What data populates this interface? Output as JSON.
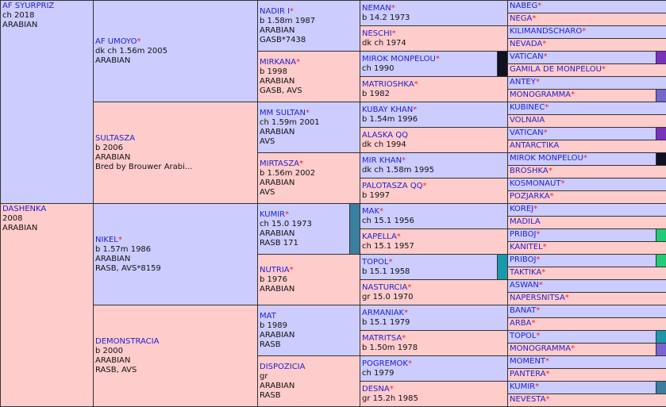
{
  "gen1": [
    {
      "name": "AF SYURPRIZ",
      "star": false,
      "lines": [
        "ch 2018",
        "ARABIAN"
      ],
      "color": "blue"
    },
    {
      "name": "DASHENKA",
      "star": false,
      "lines": [
        "2008",
        "ARABIAN"
      ],
      "color": "pink"
    }
  ],
  "gen2": [
    {
      "name": "AF UMOYO",
      "star": true,
      "lines": [
        "dk ch 1.56m 2005",
        "ARABIAN"
      ],
      "color": "blue"
    },
    {
      "name": "SULTASZA",
      "star": false,
      "lines": [
        "b 2006",
        "ARABIAN",
        "Bred by Brouwer Arabi..."
      ],
      "color": "pink"
    },
    {
      "name": "NIKEL",
      "star": true,
      "lines": [
        "b 1.57m 1986",
        "ARABIAN",
        "RASB, AVS*8159"
      ],
      "color": "blue"
    },
    {
      "name": "DEMONSTRACIA",
      "star": false,
      "lines": [
        "b 2000",
        "ARABIAN",
        "RASB, AVS"
      ],
      "color": "pink"
    }
  ],
  "gen3": [
    {
      "name": "NADIR I",
      "star": true,
      "lines": [
        "b 1.58m 1987",
        "ARABIAN",
        "GASB*7438"
      ],
      "color": "blue"
    },
    {
      "name": "MIRKANA",
      "star": true,
      "lines": [
        "b 1998",
        "ARABIAN",
        "GASB, AVS"
      ],
      "color": "pink"
    },
    {
      "name": "MM SULTAN",
      "star": true,
      "lines": [
        "ch 1.59m 2001",
        "ARABIAN",
        "AVS"
      ],
      "color": "blue"
    },
    {
      "name": "MIRTASZA",
      "star": true,
      "lines": [
        "b 1.56m 2002",
        "ARABIAN",
        "AVS"
      ],
      "color": "pink"
    },
    {
      "name": "KUMIR",
      "star": true,
      "lines": [
        "ch 15.0 1973",
        "ARABIAN",
        "RASB 171"
      ],
      "color": "blue",
      "swatch": "#3a7ea0"
    },
    {
      "name": "NUTRIA",
      "star": true,
      "lines": [
        "b 1976",
        "ARABIAN"
      ],
      "color": "pink"
    },
    {
      "name": "MAT",
      "star": false,
      "lines": [
        "b 1989",
        "ARABIAN",
        "RASB"
      ],
      "color": "blue"
    },
    {
      "name": "DISPOZICIA",
      "star": false,
      "lines": [
        "gr",
        "ARABIAN",
        "RASB"
      ],
      "color": "pink"
    }
  ],
  "gen4": [
    {
      "name": "NEMAN",
      "star": true,
      "lines": [
        "b 14.2 1973"
      ],
      "color": "blue"
    },
    {
      "name": "NESCHI",
      "star": true,
      "lines": [
        "dk ch 1974"
      ],
      "color": "pink"
    },
    {
      "name": "MIROK MONPELOU",
      "star": true,
      "lines": [
        "ch 1990"
      ],
      "color": "blue",
      "swatch": "#111122"
    },
    {
      "name": "MATRIOSHKA",
      "star": true,
      "lines": [
        "b 1982"
      ],
      "color": "pink"
    },
    {
      "name": "KUBAY KHAN",
      "star": true,
      "lines": [
        "b 1.54m 1996"
      ],
      "color": "blue"
    },
    {
      "name": "ALASKA QQ",
      "star": false,
      "lines": [
        "dk ch 1994"
      ],
      "color": "pink"
    },
    {
      "name": "MIR KHAN",
      "star": true,
      "lines": [
        "dk ch 1.58m 1995"
      ],
      "color": "blue"
    },
    {
      "name": "PALOTASZA QQ",
      "star": true,
      "lines": [
        "b 1997"
      ],
      "color": "pink"
    },
    {
      "name": "MAK",
      "star": true,
      "lines": [
        "ch 15.1 1956"
      ],
      "color": "blue"
    },
    {
      "name": "KAPELLA",
      "star": true,
      "lines": [
        "ch 15.1 1957"
      ],
      "color": "pink"
    },
    {
      "name": "TOPOL",
      "star": true,
      "lines": [
        "b 15.1 1958"
      ],
      "color": "blue",
      "swatch": "#1a99aa"
    },
    {
      "name": "NASTURCIA",
      "star": true,
      "lines": [
        "gr 15.0 1970"
      ],
      "color": "pink"
    },
    {
      "name": "ARMANIAK",
      "star": true,
      "lines": [
        "b 15.1 1979"
      ],
      "color": "blue"
    },
    {
      "name": "MATRITSA",
      "star": true,
      "lines": [
        "b 1.50m 1978"
      ],
      "color": "pink"
    },
    {
      "name": "POGREMOK",
      "star": true,
      "lines": [
        "ch 1979"
      ],
      "color": "blue"
    },
    {
      "name": "DESNA",
      "star": true,
      "lines": [
        "gr 15.2h 1985"
      ],
      "color": "pink"
    }
  ],
  "gen5": [
    {
      "name": "NABEG",
      "star": true,
      "color": "blue"
    },
    {
      "name": "NEGA",
      "star": true,
      "color": "pink"
    },
    {
      "name": "KILIMANDSCHARO",
      "star": true,
      "color": "blue"
    },
    {
      "name": "NEVADA",
      "star": true,
      "color": "pink"
    },
    {
      "name": "VATICAN",
      "star": true,
      "color": "blue",
      "swatch": "#7733bb"
    },
    {
      "name": "GAMILA DE MONPELOU",
      "star": true,
      "color": "pink"
    },
    {
      "name": "ANTEY",
      "star": true,
      "color": "blue"
    },
    {
      "name": "MONOGRAMMA",
      "star": true,
      "color": "pink",
      "swatch": "#7766cc"
    },
    {
      "name": "KUBINEC",
      "star": true,
      "color": "blue"
    },
    {
      "name": "VOLNAIA",
      "star": false,
      "color": "pink"
    },
    {
      "name": "VATICAN",
      "star": true,
      "color": "blue",
      "swatch": "#7733bb"
    },
    {
      "name": "ANTARCTIKA",
      "star": false,
      "color": "pink"
    },
    {
      "name": "MIROK MONPELOU",
      "star": true,
      "color": "blue",
      "swatch": "#111122"
    },
    {
      "name": "BROSHKA",
      "star": true,
      "color": "pink"
    },
    {
      "name": "KOSMONAUT",
      "star": true,
      "color": "blue"
    },
    {
      "name": "POZJARKA",
      "star": true,
      "color": "pink"
    },
    {
      "name": "KOREJ",
      "star": true,
      "color": "blue"
    },
    {
      "name": "MADILA",
      "star": false,
      "color": "pink"
    },
    {
      "name": "PRIBOJ",
      "star": true,
      "color": "blue",
      "swatch": "#22cc77"
    },
    {
      "name": "KANITEL",
      "star": true,
      "color": "pink"
    },
    {
      "name": "PRIBOJ",
      "star": true,
      "color": "blue",
      "swatch": "#22cc77"
    },
    {
      "name": "TAKTIKA",
      "star": true,
      "color": "pink"
    },
    {
      "name": "ASWAN",
      "star": true,
      "color": "blue"
    },
    {
      "name": "NAPERSNITSA",
      "star": true,
      "color": "pink"
    },
    {
      "name": "BANAT",
      "star": true,
      "color": "blue"
    },
    {
      "name": "ARBA",
      "star": true,
      "color": "pink"
    },
    {
      "name": "TOPOL",
      "star": true,
      "color": "blue",
      "swatch": "#1a99aa"
    },
    {
      "name": "MONOGRAMMA",
      "star": true,
      "color": "pink",
      "swatch": "#7766cc"
    },
    {
      "name": "MOMENT",
      "star": true,
      "color": "blue"
    },
    {
      "name": "PANTERA",
      "star": true,
      "color": "pink"
    },
    {
      "name": "KUMIR",
      "star": true,
      "color": "blue",
      "swatch": "#3a7ea0"
    },
    {
      "name": "NEVESTA",
      "star": true,
      "color": "pink"
    }
  ],
  "star_symbol": "*"
}
